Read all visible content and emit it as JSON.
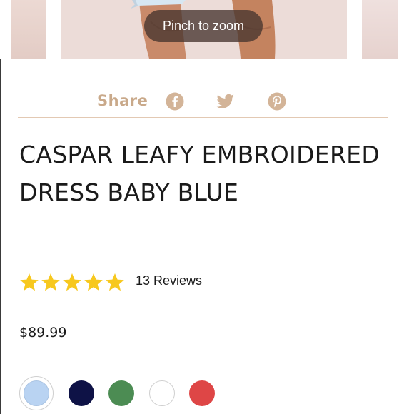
{
  "gallery": {
    "zoom_hint": "Pinch to zoom"
  },
  "share": {
    "label": "Share",
    "icons": [
      "facebook-icon",
      "twitter-icon",
      "pinterest-icon"
    ],
    "color": "#c9a98a"
  },
  "product": {
    "title": "CASPAR LEAFY EMBROIDERED DRESS BABY BLUE",
    "rating": 5,
    "reviews_label": "13 Reviews",
    "price": "$89.99",
    "star_color": "#f7c81e"
  },
  "swatches": [
    {
      "name": "baby-blue",
      "color": "#b9d3f2",
      "selected": true
    },
    {
      "name": "navy",
      "color": "#0e1246",
      "selected": false
    },
    {
      "name": "green",
      "color": "#4c8c53",
      "selected": false
    },
    {
      "name": "white",
      "color": "#ffffff",
      "selected": false
    },
    {
      "name": "red",
      "color": "#de4646",
      "selected": false
    }
  ]
}
